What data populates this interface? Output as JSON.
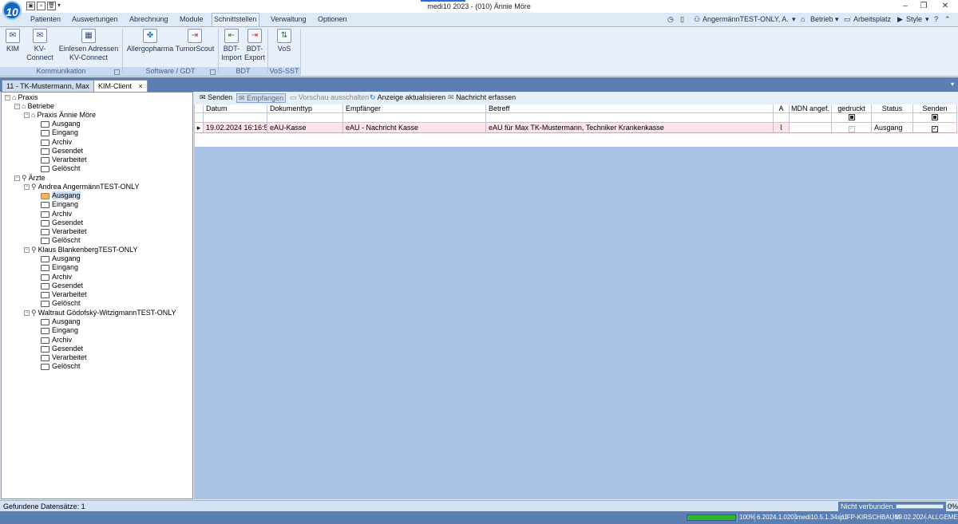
{
  "window": {
    "title": "medi10 2023 - (010) Ännie Möre",
    "logo_text": "10"
  },
  "menu": {
    "tabs": [
      "Patienten",
      "Auswertungen",
      "Abrechnung",
      "Module",
      "Schnittstellen",
      "Verwaltung",
      "Optionen"
    ],
    "active_tab": "Schnittstellen",
    "user": "AngermännTEST-ONLY, A.",
    "betrieb": "Betrieb",
    "arbeitsplatz": "Arbeitsplatz",
    "style": "Style",
    "help": "?"
  },
  "ribbon": {
    "groups": [
      {
        "label": "Kommunikation",
        "buttons": [
          "KIM",
          "KV-\nConnect",
          "Einlesen Adressen\nKV-Connect"
        ]
      },
      {
        "label": "Software / GDT",
        "buttons": [
          "Allergopharma",
          "TumorScout"
        ]
      },
      {
        "label": "BDT",
        "buttons": [
          "BDT-\nImport",
          "BDT-\nExport"
        ]
      },
      {
        "label": "VoS-SST",
        "buttons": [
          "VoS"
        ]
      }
    ]
  },
  "doc_tabs": [
    {
      "label": "11 - TK-Mustermann, Max"
    },
    {
      "label": "KIM-Client",
      "close": "×"
    }
  ],
  "tree": {
    "root": "Praxis",
    "betriebe_label": "Betriebe",
    "praxis_name": "Praxis Ännie Möre",
    "folders": [
      "Ausgang",
      "Eingang",
      "Archiv",
      "Gesendet",
      "Verarbeitet",
      "Gelöscht"
    ],
    "aerzte_label": "Ärzte",
    "doctors": [
      "Andrea AngermännTEST-ONLY",
      "Klaus BlankenbergTEST-ONLY",
      "Waltraut Gödofský-WitzigmannTEST-ONLY"
    ],
    "selected_folder": "Ausgang"
  },
  "toolbar": {
    "senden": "Senden",
    "empfangen": "Empfangen",
    "vorschau": "Vorschau ausschalten",
    "aktualisieren": "Anzeige aktualisieren",
    "erfassen": "Nachricht erfassen"
  },
  "grid": {
    "columns": [
      "Datum",
      "Dokumenttyp",
      "Empfänger",
      "Betreff",
      "A",
      "MDN angef.",
      "gedruckt",
      "Status",
      "Senden"
    ],
    "rows": [
      {
        "datum": "19.02.2024 16:16:51",
        "dokumenttyp": "eAU-Kasse",
        "empfaenger": "eAU - Nachricht Kasse",
        "betreff": "eAU für Max TK-Mustermann, Techniker Krankenkasse",
        "attachment": true,
        "mdn": "",
        "gedruckt": false,
        "status": "Ausgang",
        "senden": true
      }
    ]
  },
  "status": {
    "found": "Gefundene Datensätze: 1",
    "connection": "Nicht verbunden...",
    "connection_progress": "0%"
  },
  "statusbar": {
    "progress_label": "100%",
    "progress_value": 1.0,
    "version": "6.2024.1.0201",
    "server": "medi10.5.1.34sp1",
    "db": "UFP-KIRSCHBAUM",
    "date": "19.02.2024",
    "mode": "ALLGEMEIN"
  }
}
